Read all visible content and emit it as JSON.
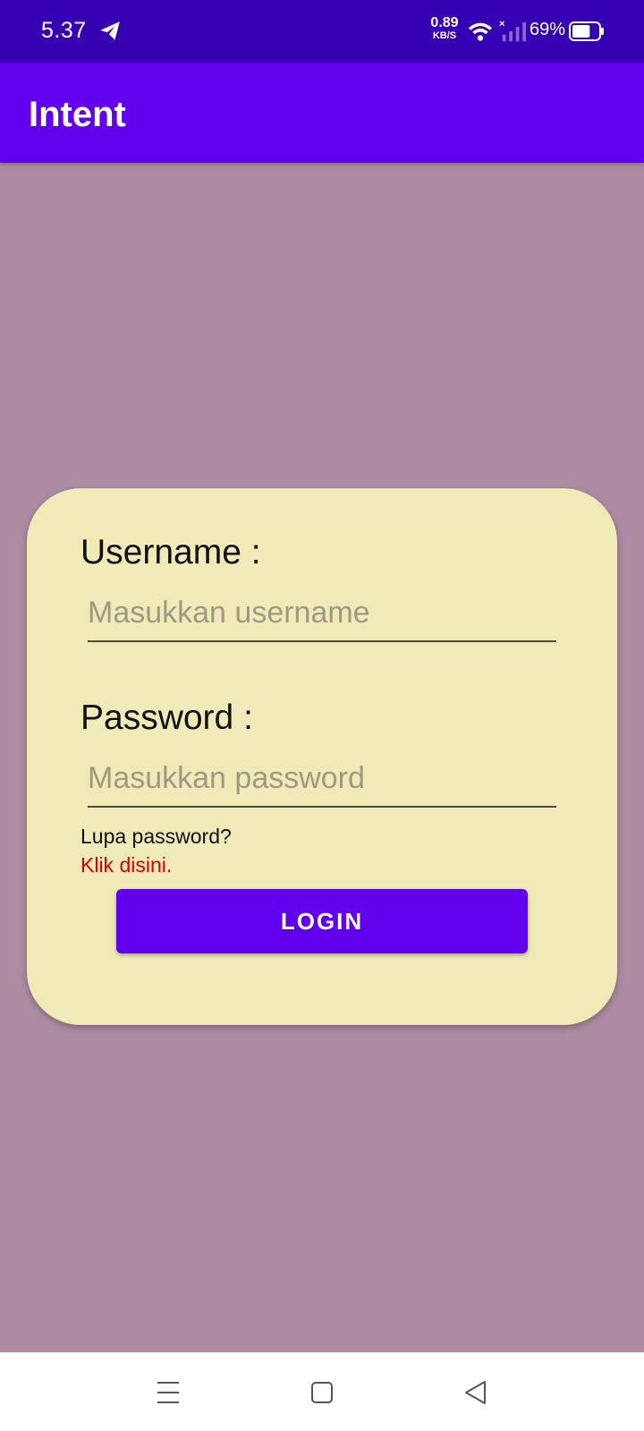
{
  "status_bar": {
    "time": "5.37",
    "net_speed_value": "0.89",
    "net_speed_unit": "KB/S",
    "battery_percent": "69%",
    "battery_level": 0.69,
    "icons": [
      "telegram-icon",
      "wifi-icon",
      "signal-icon",
      "battery-icon"
    ]
  },
  "app_bar": {
    "title": "Intent",
    "color": "#6200ee"
  },
  "login_card": {
    "username_label": "Username :",
    "username_placeholder": "Masukkan username",
    "username_value": "",
    "password_label": "Password :",
    "password_placeholder": "Masukkan password",
    "password_value": "",
    "forgot_text": "Lupa password?",
    "forgot_link": "Klik disini.",
    "login_button": "LOGIN",
    "card_color": "#efeab7",
    "link_color": "#d50000"
  },
  "background_color": "#ad8ca3",
  "nav_bar": {
    "icons": [
      "menu-icon",
      "home-icon",
      "back-icon"
    ]
  }
}
